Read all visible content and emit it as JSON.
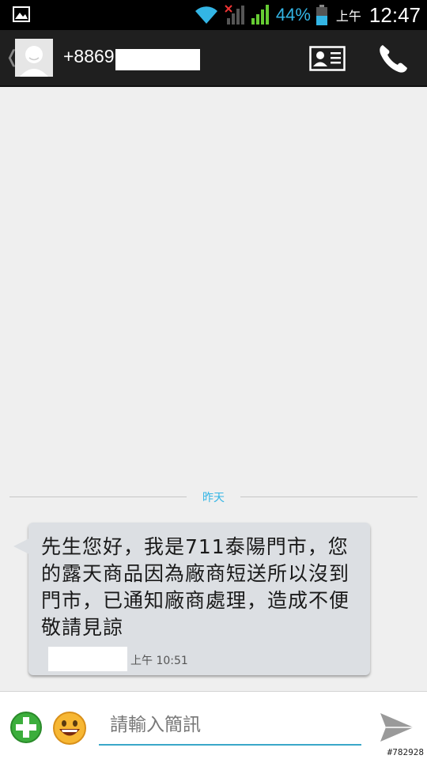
{
  "status_bar": {
    "battery_percent": "44%",
    "ampm": "上午",
    "time": "12:47",
    "icons": [
      "gallery-icon",
      "wifi-icon",
      "no-signal-icon",
      "signal-icon",
      "battery-icon"
    ]
  },
  "action_bar": {
    "back_glyph": "❬",
    "phone_number": "+8869",
    "icons": [
      "avatar-icon",
      "contact-card-icon",
      "phone-call-icon"
    ]
  },
  "conversation": {
    "date_divider": "昨天",
    "messages": [
      {
        "text": "先生您好，我是711泰陽門市，您的露天商品因為廠商短送所以沒到門市，已通知廠商處理，造成不便敬請見諒",
        "time": "上午 10:51",
        "direction": "incoming"
      }
    ]
  },
  "compose": {
    "placeholder": "請輸入簡訊",
    "icons": [
      "add-attachment-icon",
      "emoji-icon",
      "send-icon"
    ]
  },
  "watermark": "#782928",
  "colors": {
    "accent": "#33b5e5",
    "bubble": "#dcdfe3",
    "statusbar": "#000000",
    "actionbar": "#1f1f1f"
  }
}
